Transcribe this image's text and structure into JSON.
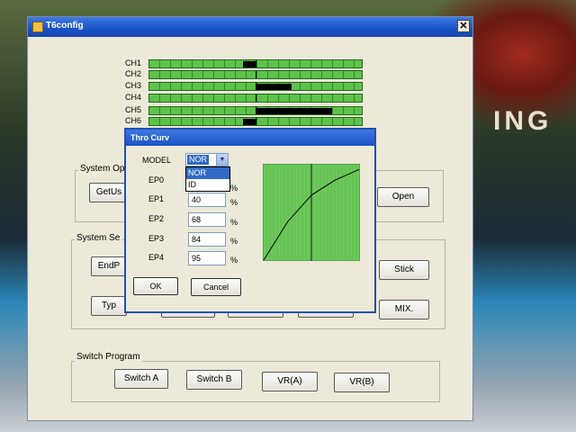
{
  "background": {
    "text": "ING"
  },
  "window": {
    "title": "T6config",
    "close_label": "✕",
    "channels": [
      {
        "label": "CH1",
        "fill_start": 0.44,
        "fill_end": 0.5
      },
      {
        "label": "CH2",
        "fill_start": 0.5,
        "fill_end": 0.5
      },
      {
        "label": "CH3",
        "fill_start": 0.5,
        "fill_end": 0.67
      },
      {
        "label": "CH4",
        "fill_start": 0.5,
        "fill_end": 0.5
      },
      {
        "label": "CH5",
        "fill_start": 0.5,
        "fill_end": 0.86
      },
      {
        "label": "CH6",
        "fill_start": 0.44,
        "fill_end": 0.5
      }
    ],
    "system_operation": {
      "label": "System Op",
      "get_user_label": "GetUs",
      "open_label": "Open"
    },
    "system_setting": {
      "label": "System Se",
      "endpoint_label": "EndP",
      "stick_label": "Stick",
      "type_label": "Typ",
      "mix_label": "MIX."
    },
    "switch_program": {
      "label": "Switch Program",
      "switch_a": "Switch A",
      "switch_b": "Switch B",
      "vr_a": "VR(A)",
      "vr_b": "VR(B)"
    }
  },
  "dialog": {
    "title": "Thro Curv",
    "model_label": "MODEL",
    "model_value": "NOR",
    "model_arrow": "▼",
    "model_options": [
      "NOR",
      "ID"
    ],
    "ep": [
      {
        "label": "EP0",
        "value": "",
        "pct": "%"
      },
      {
        "label": "EP1",
        "value": "40",
        "pct": "%"
      },
      {
        "label": "EP2",
        "value": "68",
        "pct": "%"
      },
      {
        "label": "EP3",
        "value": "84",
        "pct": "%"
      },
      {
        "label": "EP4",
        "value": "95",
        "pct": "%"
      }
    ],
    "ok_label": "OK",
    "cancel_label": "Cancel",
    "curve_points": [
      0,
      40,
      68,
      84,
      95
    ]
  },
  "colors": {
    "titlebar": "#1a52c8",
    "bar_green": "#5ec24a",
    "curve_green": "#6cc85a"
  }
}
